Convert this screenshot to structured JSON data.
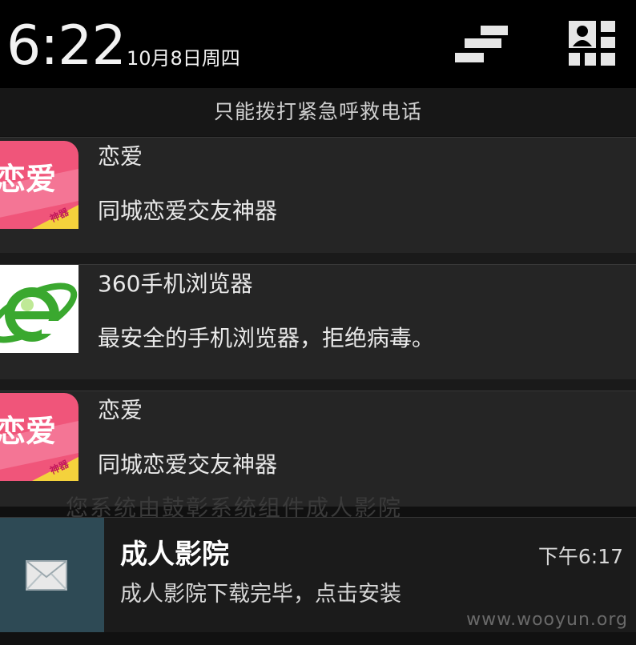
{
  "status": {
    "time": "6:22",
    "date": "10月8日周四"
  },
  "emergency_text": "只能拨打紧急呼救电话",
  "notifications": [
    {
      "title": "恋爱",
      "text": "同城恋爱交友神器",
      "icon": "love-app-icon",
      "icon_text": "恋爱",
      "icon_badge": "神器"
    },
    {
      "title": "360手机浏览器",
      "text": "最安全的手机浏览器，拒绝病毒。",
      "icon": "browser-e-icon"
    },
    {
      "title": "恋爱",
      "text": "同城恋爱交友神器",
      "icon": "love-app-icon",
      "icon_text": "恋爱",
      "icon_badge": "神器"
    }
  ],
  "message": {
    "title": "成人影院",
    "time": "下午6:17",
    "text": "成人影院下载完毕，点击安装",
    "icon": "mail-envelope-icon"
  },
  "background_hint_text": "您系统由鼓彰系统组件成人影院",
  "watermark": "www.wooyun.org",
  "colors": {
    "love_icon_pink": "#f0557a",
    "love_icon_yellow": "#f4d23c",
    "browser_green": "#3aa82f",
    "mail_tile": "#2e4a55"
  }
}
